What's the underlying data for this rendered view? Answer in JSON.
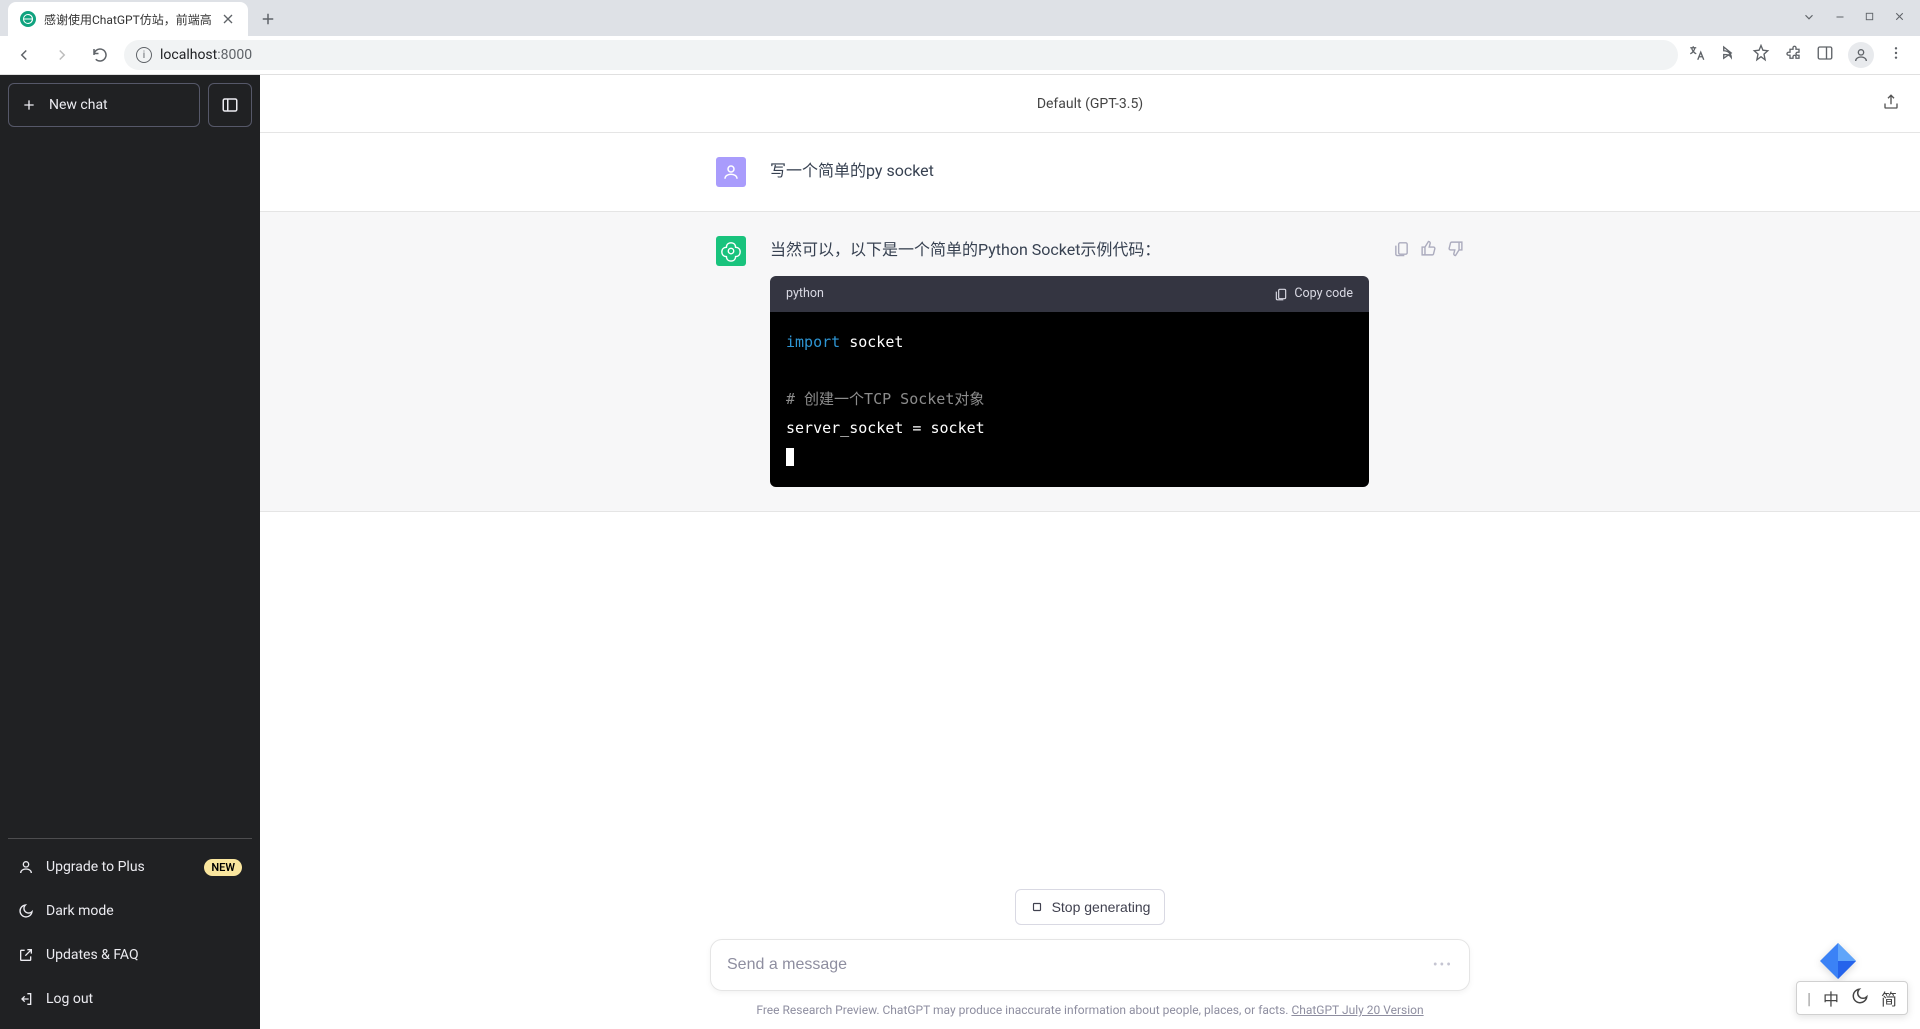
{
  "browser": {
    "tab_title": "感谢使用ChatGPT仿站，前端高",
    "url_host": "localhost",
    "url_port": ":8000"
  },
  "sidebar": {
    "new_chat": "New chat",
    "upgrade": "Upgrade to Plus",
    "upgrade_badge": "NEW",
    "dark_mode": "Dark mode",
    "updates_faq": "Updates & FAQ",
    "log_out": "Log out"
  },
  "header": {
    "model": "Default (GPT-3.5)"
  },
  "messages": {
    "user_text": "写一个简单的py socket",
    "assistant_intro": "当然可以，以下是一个简单的Python Socket示例代码：",
    "code_lang": "python",
    "copy_label": "Copy code",
    "code": {
      "kw_import": "import",
      "mod_socket": " socket",
      "blank": "",
      "comment": "# 创建一个TCP Socket对象",
      "line3": "server_socket = socket"
    }
  },
  "footer": {
    "stop": "Stop generating",
    "placeholder": "Send a message",
    "disclaimer_a": "Free Research Preview. ChatGPT may produce inaccurate information about people, places, or facts. ",
    "disclaimer_link": "ChatGPT July 20 Version"
  },
  "ime": {
    "s1": "中",
    "s2": "简"
  }
}
